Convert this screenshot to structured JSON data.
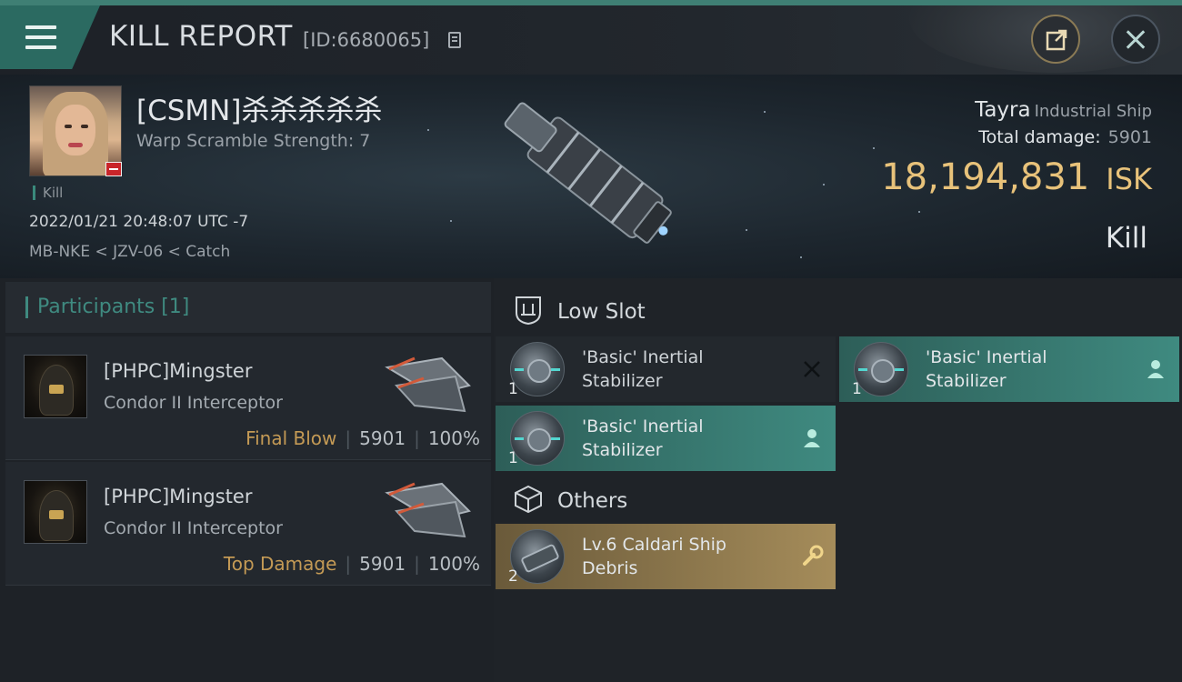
{
  "header": {
    "title": "KILL REPORT",
    "report_id": "[ID:6680065]"
  },
  "victim": {
    "name": "[CSMN]杀杀杀杀杀",
    "warp_scramble": "Warp Scramble Strength: 7",
    "tag": "Kill",
    "datetime": "2022/01/21 20:48:07 UTC -7",
    "location": "MB-NKE < JZV-06 < Catch",
    "ship_name": "Tayra",
    "ship_class": "Industrial Ship",
    "total_damage_label": "Total damage:",
    "total_damage": "5901",
    "isk_value": "18,194,831",
    "isk_unit": "ISK",
    "result": "Kill"
  },
  "participants": {
    "title": "Participants [1]",
    "list": [
      {
        "name": "[PHPC]Mingster",
        "ship": "Condor II Interceptor",
        "role": "Final Blow",
        "damage": "5901",
        "percent": "100%"
      },
      {
        "name": "[PHPC]Mingster",
        "ship": "Condor II Interceptor",
        "role": "Top Damage",
        "damage": "5901",
        "percent": "100%"
      }
    ]
  },
  "sections": {
    "low_slot": "Low Slot",
    "others": "Others"
  },
  "items": {
    "low": [
      {
        "name": "'Basic' Inertial Stabilizer",
        "qty": "1",
        "status": "destroyed"
      },
      {
        "name": "'Basic' Inertial Stabilizer",
        "qty": "1",
        "status": "dropped"
      },
      {
        "name": "'Basic' Inertial Stabilizer",
        "qty": "1",
        "status": "dropped"
      }
    ],
    "others": [
      {
        "name": "Lv.6 Caldari Ship Debris",
        "qty": "2",
        "status": "salvage"
      }
    ]
  },
  "colors": {
    "accent_teal": "#3f8a80",
    "isk_gold": "#e8c27a",
    "final_blow": "#c49a55"
  }
}
